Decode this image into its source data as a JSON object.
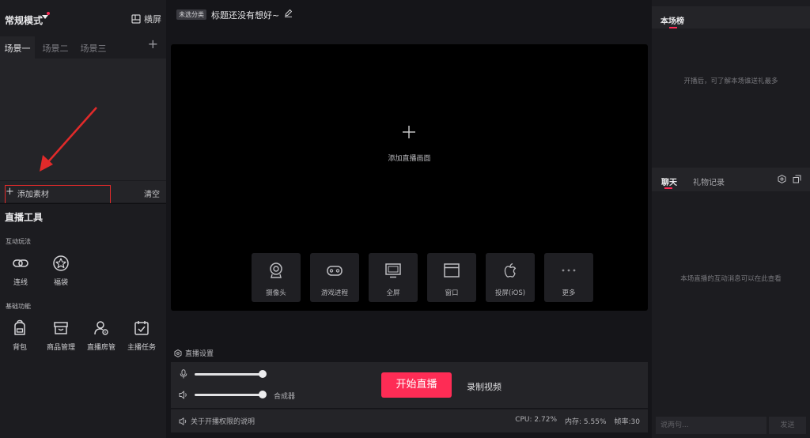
{
  "left_panel": {
    "mode_title": "常规模式",
    "landscape_label": "横屏",
    "scene_tabs": [
      "场景一",
      "场景二",
      "场景三"
    ],
    "add_material_label": "添加素材",
    "clear_label": "清空",
    "tools_title": "直播工具",
    "interactive_section": "互动玩法",
    "interactive_tools": [
      {
        "label": "连线",
        "icon": "link-icon"
      },
      {
        "label": "福袋",
        "icon": "star-bag-icon"
      }
    ],
    "basic_section": "基础功能",
    "basic_tools": [
      {
        "label": "背包",
        "icon": "backpack-icon"
      },
      {
        "label": "商品管理",
        "icon": "store-icon"
      },
      {
        "label": "直播房管",
        "icon": "room-admin-icon"
      },
      {
        "label": "主播任务",
        "icon": "task-icon"
      }
    ]
  },
  "center": {
    "category_badge": "未选分类",
    "stream_title": "标题还没有想好~",
    "add_screen_label": "添加直播画面",
    "sources": [
      {
        "label": "摄像头",
        "icon": "camera-icon"
      },
      {
        "label": "游戏进程",
        "icon": "gamepad-icon"
      },
      {
        "label": "全屏",
        "icon": "monitor-icon"
      },
      {
        "label": "窗口",
        "icon": "window-icon"
      },
      {
        "label": "投屏(iOS)",
        "icon": "apple-icon"
      },
      {
        "label": "更多",
        "icon": "more-icon"
      }
    ],
    "live_settings_label": "直播设置",
    "mic_volume_level": 1.0,
    "speaker_volume_level": 1.0,
    "mixer_label": "合成器",
    "start_button": "开始直播",
    "record_button": "录制视频",
    "permission_note": "关于开播权限的说明",
    "cpu": "CPU: 2.72%",
    "memory": "内存: 5.55%",
    "fps": "帧率:30"
  },
  "right_panel": {
    "rank_title": "本场榜",
    "rank_empty": "开播后，可了解本场谁送礼最多",
    "chat_tab": "聊天",
    "gift_tab": "礼物记录",
    "chat_empty": "本场直播的互动消息可以在此查看",
    "chat_placeholder": "说两句...",
    "send_button": "发送"
  },
  "colors": {
    "accent": "#fe2c55",
    "annotation": "#e12a2a",
    "panel": "#1c1c20",
    "panel_light": "#242428",
    "background": "#151519"
  }
}
